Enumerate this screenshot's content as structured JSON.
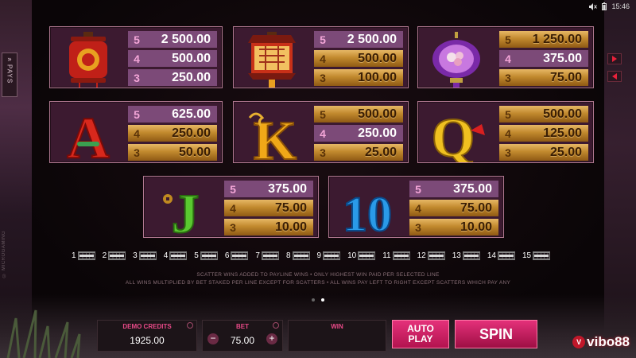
{
  "status_bar": {
    "mute_icon": "speaker-muted-icon",
    "battery_icon": "battery-icon",
    "time": "15:46"
  },
  "side_tab": {
    "chevron": "»",
    "label": "PAYS"
  },
  "vertical_note": "© MICROGAMING",
  "nav": {
    "next_icon": "arrow-right-icon",
    "prev_icon": "arrow-left-icon"
  },
  "paytable": [
    {
      "symbol": "red-lantern",
      "rows": [
        {
          "count": "5",
          "pay": "2 500.00",
          "style": "purple"
        },
        {
          "count": "4",
          "pay": "500.00",
          "style": "purple"
        },
        {
          "count": "3",
          "pay": "250.00",
          "style": "purple"
        }
      ]
    },
    {
      "symbol": "hanging-lantern",
      "rows": [
        {
          "count": "5",
          "pay": "2 500.00",
          "style": "purple"
        },
        {
          "count": "4",
          "pay": "500.00",
          "style": "gold"
        },
        {
          "count": "3",
          "pay": "100.00",
          "style": "gold"
        }
      ]
    },
    {
      "symbol": "purple-flower-lantern",
      "rows": [
        {
          "count": "5",
          "pay": "1 250.00",
          "style": "gold"
        },
        {
          "count": "4",
          "pay": "375.00",
          "style": "purple"
        },
        {
          "count": "3",
          "pay": "75.00",
          "style": "gold"
        }
      ]
    },
    {
      "symbol": "letter-a",
      "letter": "A",
      "rows": [
        {
          "count": "5",
          "pay": "625.00",
          "style": "purple"
        },
        {
          "count": "4",
          "pay": "250.00",
          "style": "gold"
        },
        {
          "count": "3",
          "pay": "50.00",
          "style": "gold"
        }
      ]
    },
    {
      "symbol": "letter-k",
      "letter": "K",
      "rows": [
        {
          "count": "5",
          "pay": "500.00",
          "style": "gold"
        },
        {
          "count": "4",
          "pay": "250.00",
          "style": "purple"
        },
        {
          "count": "3",
          "pay": "25.00",
          "style": "gold"
        }
      ]
    },
    {
      "symbol": "letter-q",
      "letter": "Q",
      "rows": [
        {
          "count": "5",
          "pay": "500.00",
          "style": "gold"
        },
        {
          "count": "4",
          "pay": "125.00",
          "style": "gold"
        },
        {
          "count": "3",
          "pay": "25.00",
          "style": "gold"
        }
      ]
    },
    {
      "symbol": "letter-j",
      "letter": "J",
      "rows": [
        {
          "count": "5",
          "pay": "375.00",
          "style": "purple"
        },
        {
          "count": "4",
          "pay": "75.00",
          "style": "gold"
        },
        {
          "count": "3",
          "pay": "10.00",
          "style": "gold"
        }
      ]
    },
    {
      "symbol": "number-10",
      "letter": "10",
      "rows": [
        {
          "count": "5",
          "pay": "375.00",
          "style": "purple"
        },
        {
          "count": "4",
          "pay": "75.00",
          "style": "gold"
        },
        {
          "count": "3",
          "pay": "10.00",
          "style": "gold"
        }
      ]
    }
  ],
  "paylines": [
    "1",
    "2",
    "3",
    "4",
    "5",
    "6",
    "7",
    "8",
    "9",
    "10",
    "11",
    "12",
    "13",
    "14",
    "15"
  ],
  "rules": {
    "line1": "SCATTER WINS ADDED TO PAYLINE WINS  •  ONLY HIGHEST WIN PAID PER SELECTED LINE",
    "line2": "ALL WINS MULTIPLIED BY BET STAKED PER LINE EXCEPT FOR SCATTERS  •  ALL WINS PAY LEFT TO RIGHT EXCEPT SCATTERS WHICH PAY ANY"
  },
  "pager": {
    "pages": 2,
    "current": 2
  },
  "controls": {
    "demo_credits_label": "DEMO CREDITS",
    "demo_credits_value": "1925.00",
    "bet_label": "BET",
    "bet_value": "75.00",
    "bet_minus": "−",
    "bet_plus": "+",
    "win_label": "WIN",
    "win_value": "",
    "autoplay_line1": "AUTO",
    "autoplay_line2": "PLAY",
    "spin_label": "SPIN"
  },
  "watermark": {
    "badge": "V",
    "text": "vibo88"
  },
  "colors": {
    "accent_pink": "#e4317a",
    "card_border": "#b07890",
    "gold": "#c28a2e",
    "purple_row": "#7c4a78"
  }
}
